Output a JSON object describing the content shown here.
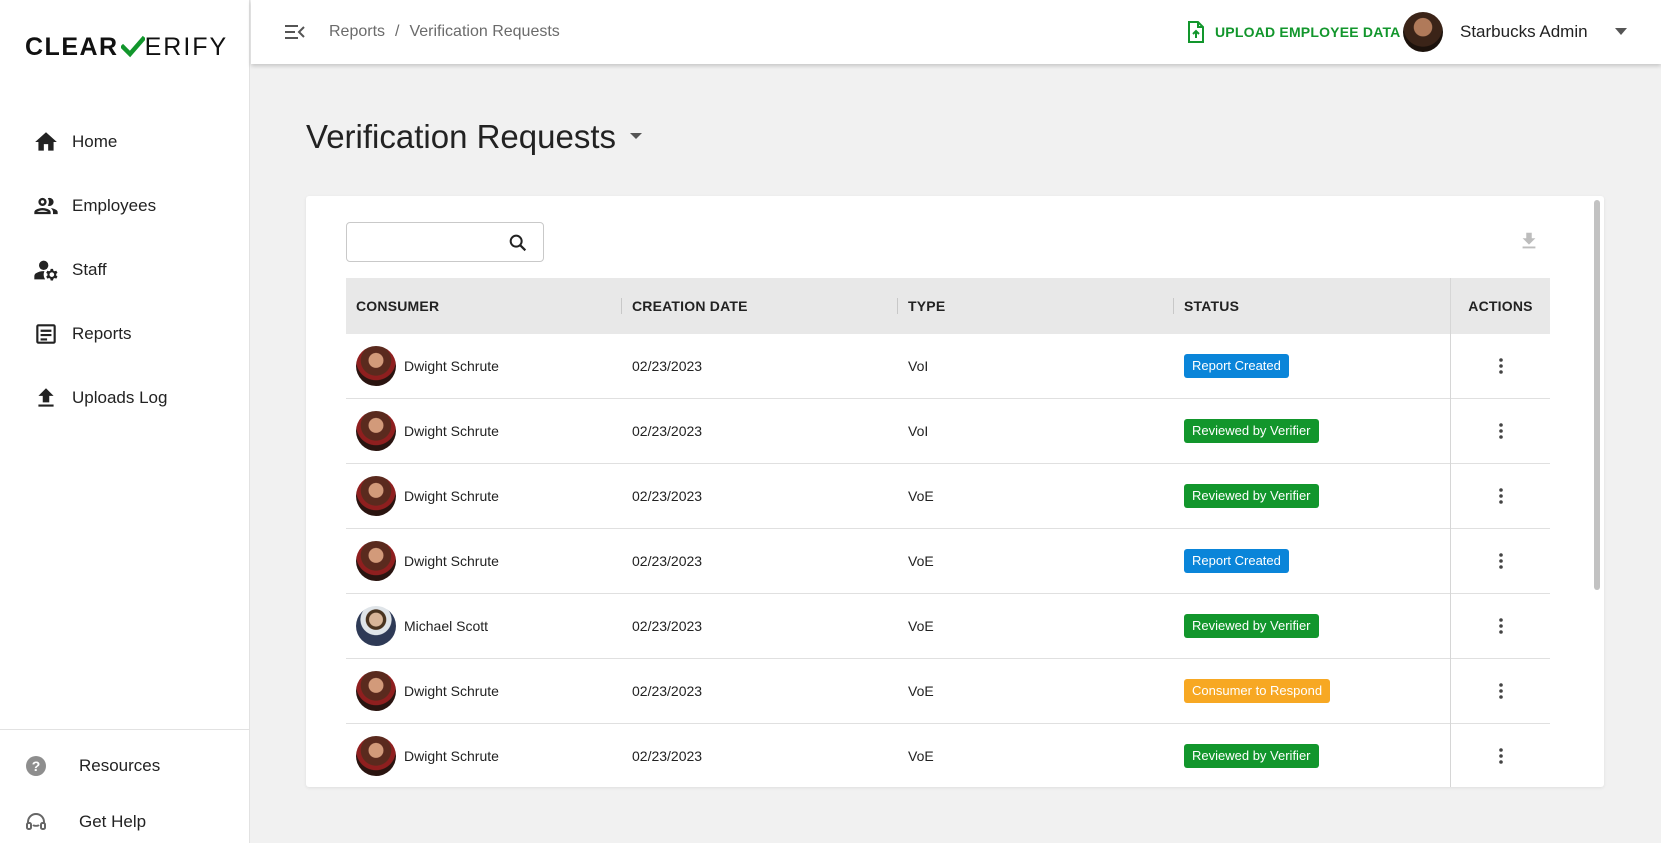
{
  "logo": {
    "part1": "CLEAR",
    "part2": "ERIFY",
    "check_color": "#12962c"
  },
  "sidebar": {
    "items": [
      {
        "label": "Home",
        "icon": "home-icon"
      },
      {
        "label": "Employees",
        "icon": "people-icon"
      },
      {
        "label": "Staff",
        "icon": "staff-gear-icon"
      },
      {
        "label": "Reports",
        "icon": "reports-icon"
      },
      {
        "label": "Uploads Log",
        "icon": "upload-icon"
      }
    ],
    "footer": [
      {
        "label": "Resources",
        "icon": "help-circle-icon"
      },
      {
        "label": "Get Help",
        "icon": "headset-icon"
      }
    ]
  },
  "topbar": {
    "breadcrumb": [
      "Reports",
      "Verification Requests"
    ],
    "separator": "/",
    "upload_label": "UPLOAD EMPLOYEE DATA",
    "user_name": "Starbucks Admin"
  },
  "main": {
    "title": "Verification Requests",
    "search": {
      "value": "",
      "placeholder": ""
    },
    "columns": [
      "CONSUMER",
      "CREATION DATE",
      "TYPE",
      "STATUS",
      "ACTIONS"
    ],
    "rows": [
      {
        "consumer": "Dwight Schrute",
        "avatar": "dwight",
        "date": "02/23/2023",
        "type": "VoI",
        "status": "Report Created",
        "status_color": "#0a85d9"
      },
      {
        "consumer": "Dwight Schrute",
        "avatar": "dwight",
        "date": "02/23/2023",
        "type": "VoI",
        "status": "Reviewed by Verifier",
        "status_color": "#12962c"
      },
      {
        "consumer": "Dwight Schrute",
        "avatar": "dwight",
        "date": "02/23/2023",
        "type": "VoE",
        "status": "Reviewed by Verifier",
        "status_color": "#12962c"
      },
      {
        "consumer": "Dwight Schrute",
        "avatar": "dwight",
        "date": "02/23/2023",
        "type": "VoE",
        "status": "Report Created",
        "status_color": "#0a85d9"
      },
      {
        "consumer": "Michael Scott",
        "avatar": "michael",
        "date": "02/23/2023",
        "type": "VoE",
        "status": "Reviewed by Verifier",
        "status_color": "#12962c"
      },
      {
        "consumer": "Dwight Schrute",
        "avatar": "dwight",
        "date": "02/23/2023",
        "type": "VoE",
        "status": "Consumer to Respond",
        "status_color": "#f7a823"
      },
      {
        "consumer": "Dwight Schrute",
        "avatar": "dwight",
        "date": "02/23/2023",
        "type": "VoE",
        "status": "Reviewed by Verifier",
        "status_color": "#12962c"
      }
    ]
  }
}
